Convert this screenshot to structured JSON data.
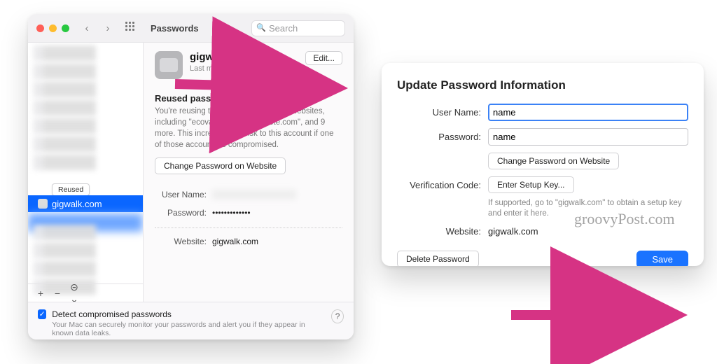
{
  "main": {
    "title": "Passwords",
    "search_placeholder": "Search",
    "sidebar": {
      "reused_tag": "Reused",
      "selected_item": "gigwalk.com",
      "toolbar": {
        "add": "+",
        "remove": "−",
        "more": "⊝ ⌄"
      }
    },
    "detail": {
      "site_title": "gigwalk.com",
      "last_modified": "Last modified 1/19/20",
      "edit": "Edit...",
      "reused_title": "Reused password",
      "reused_body": "You're reusing this password on other websites, including \"ecovacs.com\", \"evernote.com\", and 9 more. This increases the risk to this account if one of those accounts is compromised.",
      "change_pw_btn": "Change Password on Website",
      "username_label": "User Name:",
      "password_label": "Password:",
      "password_mask": "•••••••••••••",
      "website_label": "Website:",
      "website_value": "gigwalk.com"
    },
    "footer": {
      "checkbox_label": "Detect compromised passwords",
      "checkbox_sub": "Your Mac can securely monitor your passwords and alert you if they appear in known data leaks.",
      "help": "?"
    }
  },
  "side": {
    "title": "Update Password Information",
    "username_label": "User Name:",
    "username_value": "name",
    "password_label": "Password:",
    "password_value": "name",
    "change_pw_btn": "Change Password on Website",
    "verification_label": "Verification Code:",
    "setup_btn": "Enter Setup Key...",
    "setup_hint": "If supported, go to \"gigwalk.com\" to obtain a setup key and enter it here.",
    "website_label": "Website:",
    "website_value": "gigwalk.com",
    "delete_btn": "Delete Password",
    "save_btn": "Save"
  },
  "watermark": "groovyPost.com"
}
